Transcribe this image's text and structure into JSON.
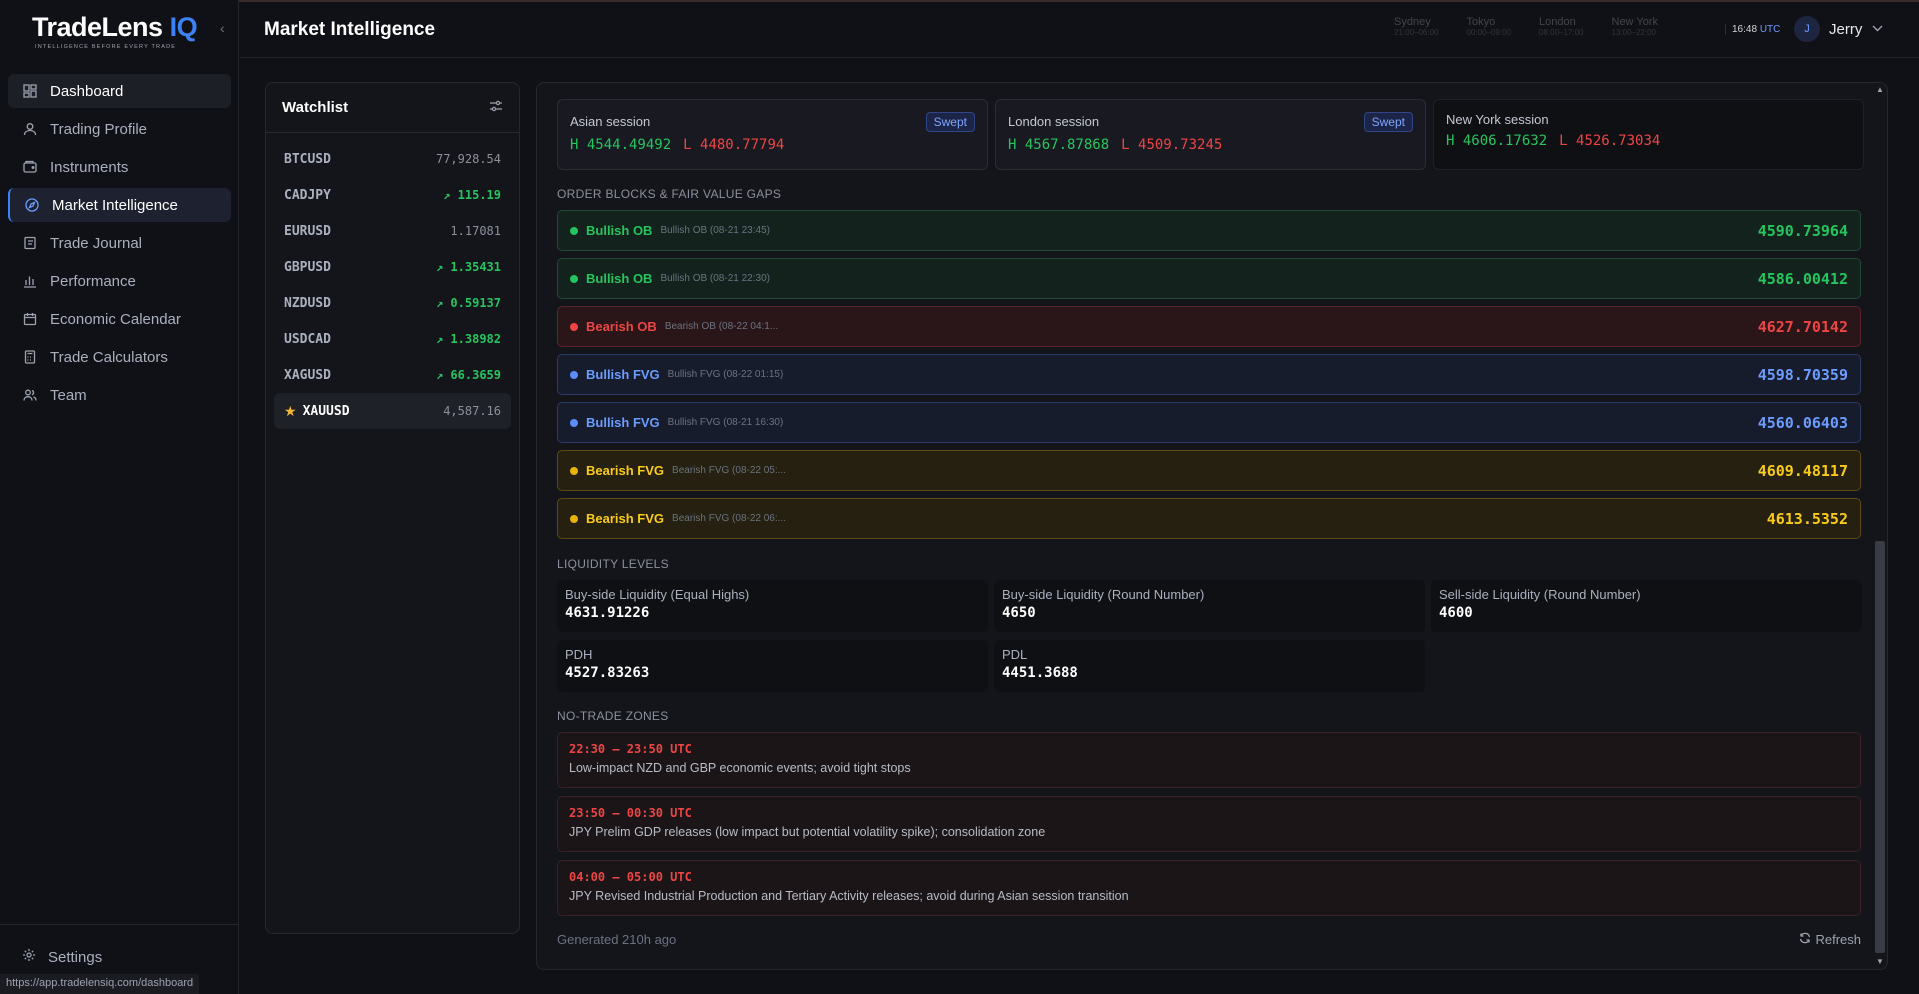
{
  "app": {
    "logo_main": "TradeLens",
    "logo_accent": "IQ",
    "tagline": "INTELLIGENCE BEFORE EVERY TRADE"
  },
  "sidebar": {
    "items": [
      {
        "label": "Dashboard",
        "icon": "dashboard-icon"
      },
      {
        "label": "Trading Profile",
        "icon": "user-icon"
      },
      {
        "label": "Instruments",
        "icon": "wallet-icon"
      },
      {
        "label": "Market Intelligence",
        "icon": "compass-icon"
      },
      {
        "label": "Trade Journal",
        "icon": "journal-icon"
      },
      {
        "label": "Performance",
        "icon": "bar-chart-icon"
      },
      {
        "label": "Economic Calendar",
        "icon": "calendar-icon"
      },
      {
        "label": "Trade Calculators",
        "icon": "calculator-icon"
      },
      {
        "label": "Team",
        "icon": "team-icon"
      }
    ],
    "settings_label": "Settings",
    "status_url": "https://app.tradelensiq.com/dashboard"
  },
  "header": {
    "title": "Market Intelligence",
    "sessions": [
      {
        "name": "Sydney",
        "time": "21:00–06:00"
      },
      {
        "name": "Tokyo",
        "time": "00:00–09:00"
      },
      {
        "name": "London",
        "time": "08:00–17:00"
      },
      {
        "name": "New York",
        "time": "13:00–22:00"
      }
    ],
    "clock_time": "16:48",
    "clock_zone": "UTC",
    "user_initial": "J",
    "user_name": "Jerry"
  },
  "watchlist": {
    "title": "Watchlist",
    "items": [
      {
        "symbol": "BTCUSD",
        "price": "77,928.54",
        "trend": ""
      },
      {
        "symbol": "CADJPY",
        "price": "115.19",
        "trend": "up"
      },
      {
        "symbol": "EURUSD",
        "price": "1.17081",
        "trend": ""
      },
      {
        "symbol": "GBPUSD",
        "price": "1.35431",
        "trend": "up"
      },
      {
        "symbol": "NZDUSD",
        "price": "0.59137",
        "trend": "up"
      },
      {
        "symbol": "USDCAD",
        "price": "1.38982",
        "trend": "up"
      },
      {
        "symbol": "XAGUSD",
        "price": "66.3659",
        "trend": "up"
      },
      {
        "symbol": "XAUUSD",
        "price": "4,587.16",
        "trend": "",
        "selected": true
      }
    ]
  },
  "sessions": [
    {
      "name": "Asian session",
      "high": "4544.49492",
      "low": "4480.77794",
      "badge": "Swept"
    },
    {
      "name": "London session",
      "high": "4567.87868",
      "low": "4509.73245",
      "badge": "Swept"
    },
    {
      "name": "New York session",
      "high": "4606.17632",
      "low": "4526.73034",
      "badge": ""
    }
  ],
  "ob_section_label": "ORDER BLOCKS & FAIR VALUE GAPS",
  "order_blocks": [
    {
      "label": "Bullish OB",
      "sub": "Bullish OB (08-21 23:45)",
      "value": "4590.73964",
      "color": "#22c55e"
    },
    {
      "label": "Bullish OB",
      "sub": "Bullish OB (08-21 22:30)",
      "value": "4586.00412",
      "color": "#22c55e"
    },
    {
      "label": "Bearish OB",
      "sub": "Bearish OB (08-22 04:1...",
      "value": "4627.70142",
      "color": "#ef4444"
    },
    {
      "label": "Bullish FVG",
      "sub": "Bullish FVG (08-22 01:15)",
      "value": "4598.70359",
      "color": "#6b9cff"
    },
    {
      "label": "Bullish FVG",
      "sub": "Bullish FVG (08-21 16:30)",
      "value": "4560.06403",
      "color": "#6b9cff"
    },
    {
      "label": "Bearish FVG",
      "sub": "Bearish FVG (08-22 05:...",
      "value": "4609.48117",
      "color": "#facc15"
    },
    {
      "label": "Bearish FVG",
      "sub": "Bearish FVG (08-22 06:...",
      "value": "4613.5352",
      "color": "#facc15"
    }
  ],
  "liq_section_label": "LIQUIDITY LEVELS",
  "liquidity": [
    {
      "name": "Buy-side Liquidity (Equal Highs)",
      "value": "4631.91226"
    },
    {
      "name": "Buy-side Liquidity (Round Number)",
      "value": "4650"
    },
    {
      "name": "Sell-side Liquidity (Round Number)",
      "value": "4600"
    },
    {
      "name": "PDH",
      "value": "4527.83263"
    },
    {
      "name": "PDL",
      "value": "4451.3688"
    }
  ],
  "ntz_section_label": "NO-TRADE ZONES",
  "no_trade_zones": [
    {
      "time": "22:30 – 23:50 UTC",
      "desc": "Low-impact NZD and GBP economic events; avoid tight stops"
    },
    {
      "time": "23:50 – 00:30 UTC",
      "desc": "JPY Prelim GDP releases (low impact but potential volatility spike); consolidation zone"
    },
    {
      "time": "04:00 – 05:00 UTC",
      "desc": "JPY Revised Industrial Production and Tertiary Activity releases; avoid during Asian session transition"
    }
  ],
  "footer": {
    "generated": "Generated 210h ago",
    "refresh_label": "Refresh"
  }
}
